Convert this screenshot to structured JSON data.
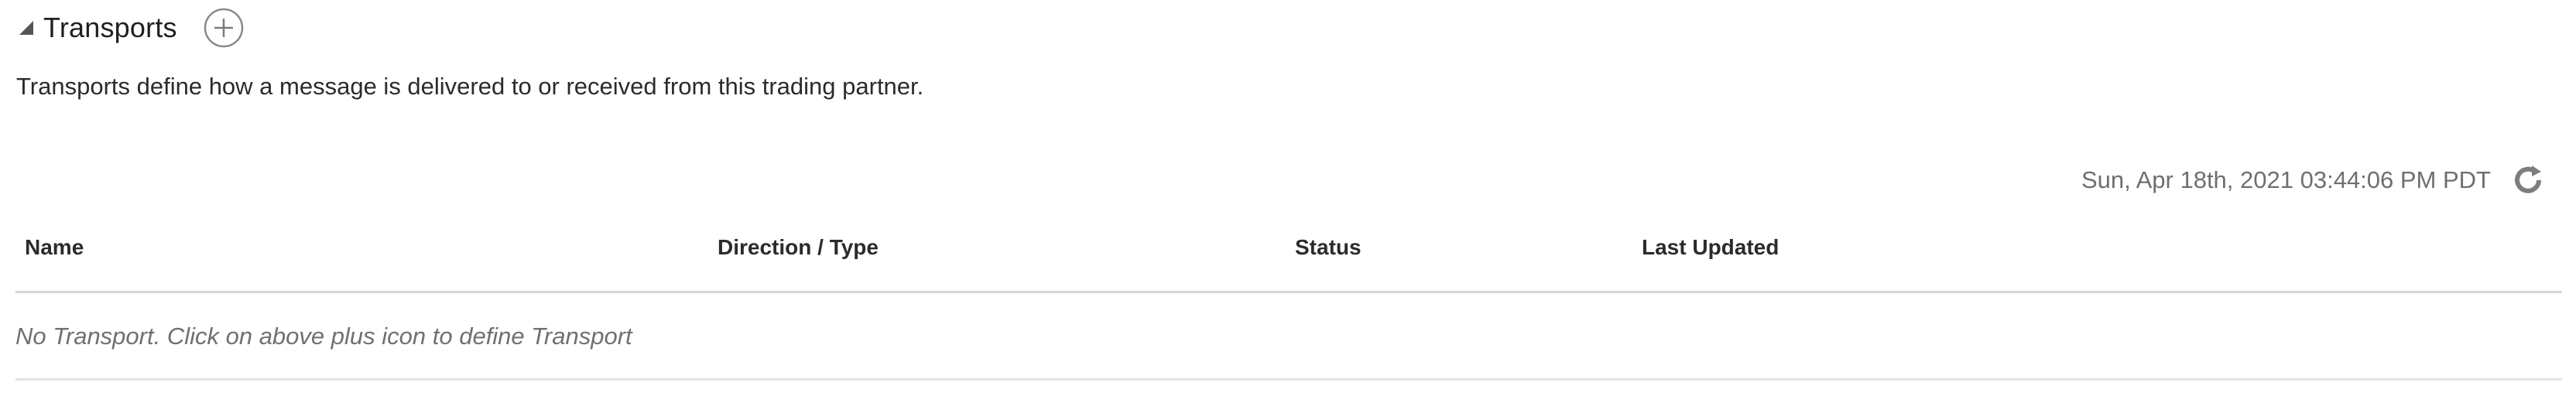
{
  "section": {
    "title": "Transports",
    "description": "Transports define how a message is delivered to or received from this trading partner.",
    "toggle_icon": "collapse-triangle-icon",
    "add_icon": "plus-circle-icon"
  },
  "toolbar": {
    "timestamp": "Sun, Apr 18th, 2021 03:44:06 PM PDT",
    "refresh_icon": "refresh-icon"
  },
  "table": {
    "columns": [
      "Name",
      "Direction / Type",
      "Status",
      "Last Updated"
    ],
    "empty_message": "No Transport. Click on above plus icon to define Transport"
  },
  "colors": {
    "text": "#2b2b2b",
    "muted": "#6f6f6f",
    "border": "#d6d6d6"
  }
}
